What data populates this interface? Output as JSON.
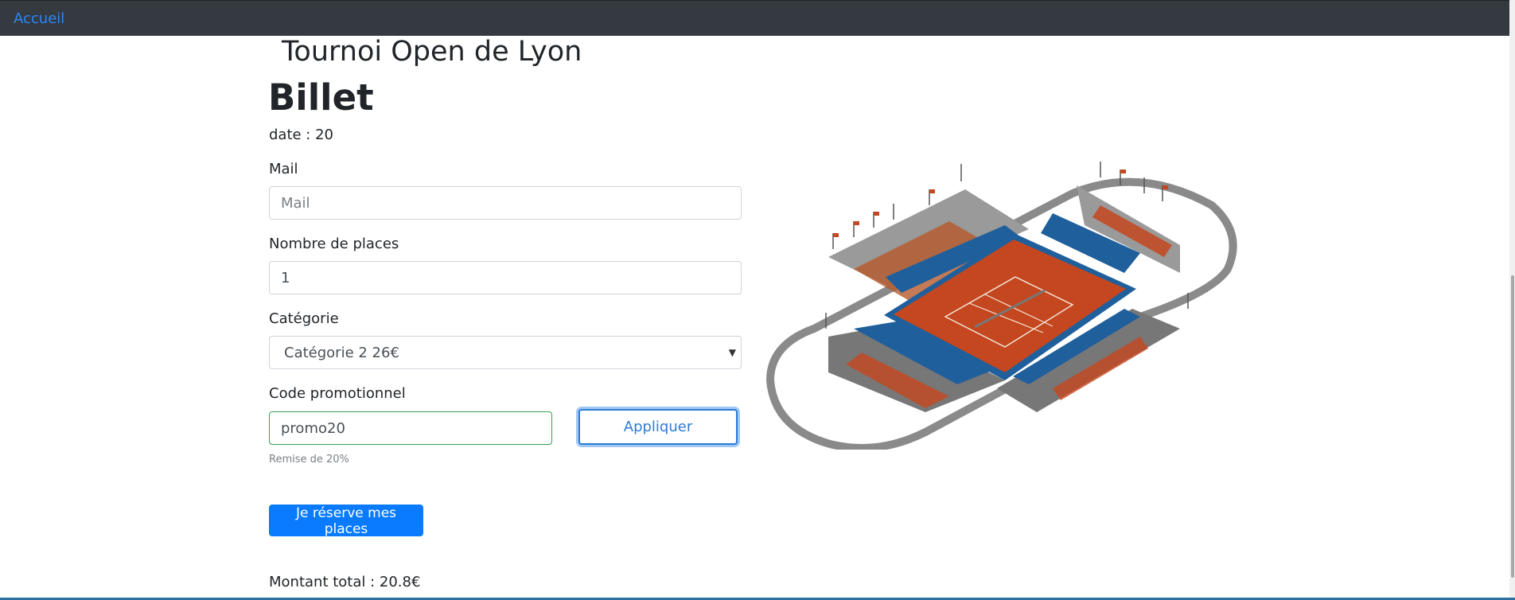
{
  "navbar": {
    "home_link": "Accueil"
  },
  "page": {
    "tournament_title": "Tournoi Open de Lyon",
    "heading": "Billet",
    "date_line": "date : 20"
  },
  "form": {
    "mail_label": "Mail",
    "mail_placeholder": "Mail",
    "mail_value": "",
    "places_label": "Nombre de places",
    "places_value": "1",
    "category_label": "Catégorie",
    "category_selected": "Catégorie 2 26€",
    "promo_label": "Code promotionnel",
    "promo_value": "promo20",
    "apply_button": "Appliquer",
    "promo_hint": "Remise de 20%",
    "submit_button": "Je réserve mes places"
  },
  "summary": {
    "total": "Montant total : 20.8€"
  },
  "colors": {
    "navbar": "#343a40",
    "link": "#2f86f6",
    "primary": "#0a7bff",
    "court_clay": "#c4471f",
    "seats_blue": "#1f5f9c"
  }
}
